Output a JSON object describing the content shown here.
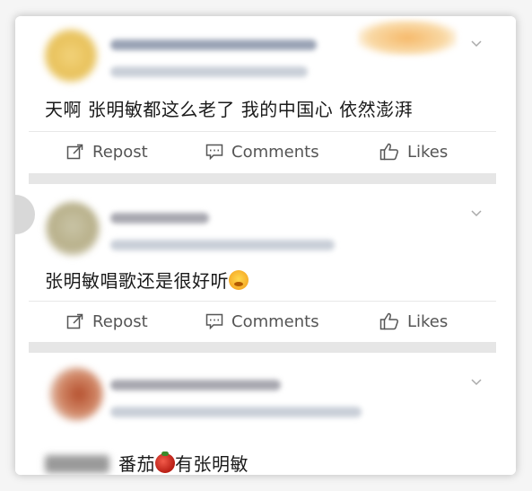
{
  "actions": {
    "repost": "Repost",
    "comments": "Comments",
    "likes": "Likes"
  },
  "posts": [
    {
      "content": "天啊 张明敏都这么老了 我的中国心 依然澎湃"
    },
    {
      "content": "张明敏唱歌还是很好听"
    },
    {
      "content_before_emoji": "番茄",
      "content_after_emoji": "有张明敏"
    }
  ],
  "colors": {
    "text": "#1a1a1a",
    "action_text": "#555555",
    "divider": "#e6e6e6"
  },
  "icons": [
    "repost-icon",
    "comments-icon",
    "likes-icon",
    "chevron-down-icon"
  ]
}
